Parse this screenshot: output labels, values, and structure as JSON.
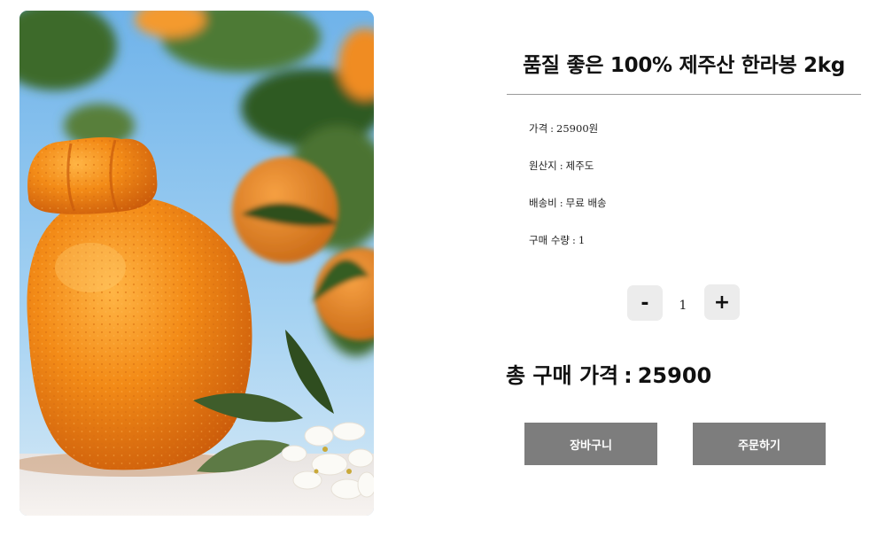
{
  "product": {
    "title": "품질 좋은 100% 제주산 한라봉 2kg",
    "image_alt": "한라봉"
  },
  "details": [
    {
      "label": "가격",
      "value": "25900원"
    },
    {
      "label": "원산지",
      "value": "제주도"
    },
    {
      "label": "배송비",
      "value": "무료 배송"
    },
    {
      "label": "구매 수량",
      "value": "1"
    }
  ],
  "detail_separator": ":",
  "quantity": {
    "minus_label": "-",
    "value": "1",
    "plus_label": "+"
  },
  "total": {
    "label": "총 구매 가격",
    "separator": ":",
    "value": "25900"
  },
  "buttons": {
    "cart": "장바구니",
    "order": "주문하기"
  },
  "colors": {
    "button_bg": "#7d7d7d",
    "stepper_bg": "#ececec",
    "divider": "#9a9a9a",
    "orange": "#f08a1c",
    "sky": "#8fc3ea"
  }
}
